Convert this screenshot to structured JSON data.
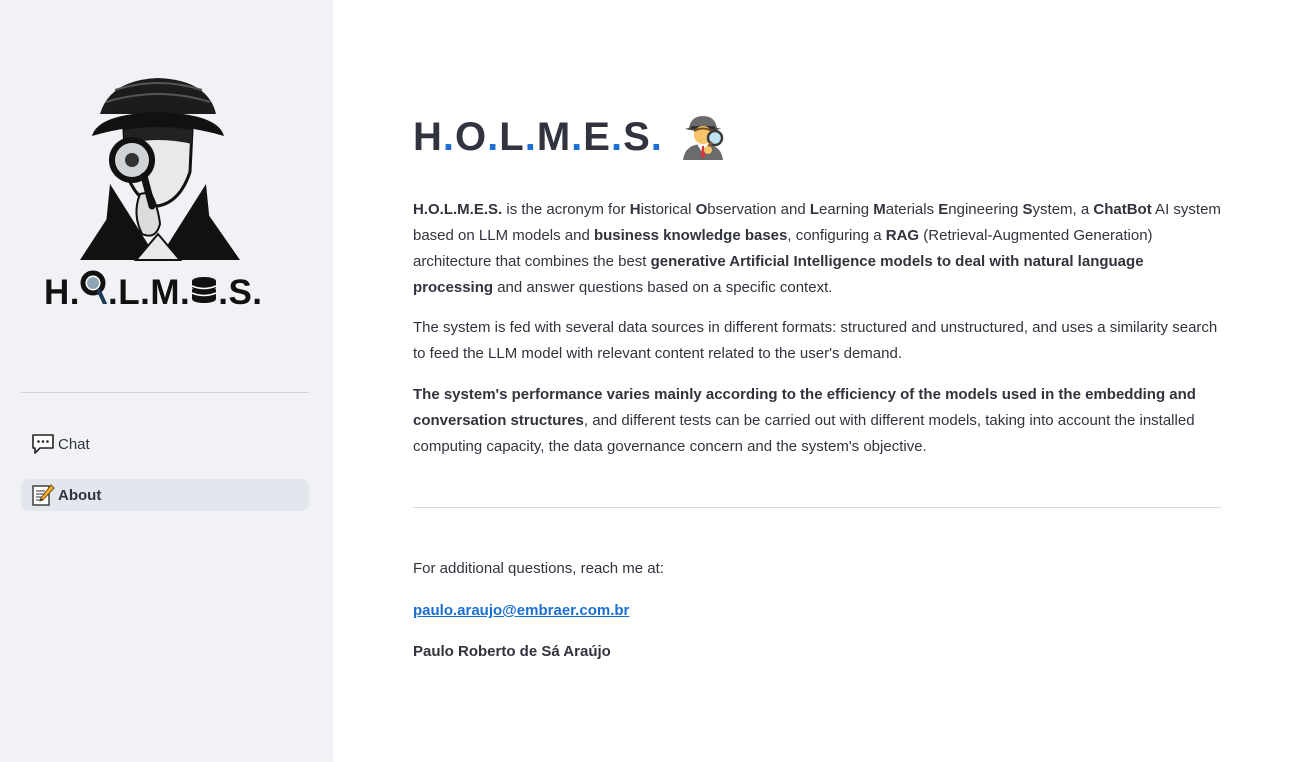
{
  "sidebar": {
    "logo_text": {
      "part1": "H.",
      "part2": ".L.M.",
      "part3": ".S."
    },
    "nav": [
      {
        "label": "Chat",
        "icon": "speech-balloon-icon",
        "active": false
      },
      {
        "label": "About",
        "icon": "memo-icon",
        "active": true
      }
    ]
  },
  "main": {
    "title": {
      "letters": [
        "H",
        "O",
        "L",
        "M",
        "E",
        "S"
      ],
      "icon": "detective-icon"
    },
    "para1": {
      "s1": "H.O.L.M.E.S.",
      "s2": " is the acronym for ",
      "h": "H",
      "h_rest": "istorical ",
      "o": "O",
      "o_rest": "bservation and ",
      "l": "L",
      "l_rest": "earning ",
      "m": "M",
      "m_rest": "aterials ",
      "e": "E",
      "e_rest": "ngineering ",
      "s": "S",
      "s_rest": "ystem, a ",
      "chatbot": "ChatBot",
      "s3": " AI system based on LLM models and ",
      "bkb": "business knowledge bases",
      "s4": ", configuring a ",
      "rag": "RAG",
      "s5": " (Retrieval-Augmented Generation) architecture that combines the best ",
      "gen": "generative Artificial Intelligence models to deal with natural language processing",
      "s6": " and answer questions based on a specific context."
    },
    "para2": "The system is fed with several data sources in different formats: structured and unstructured, and uses a similarity search to feed the LLM model with relevant content related to the user's demand.",
    "para3": {
      "bold": "The system's performance varies mainly according to the efficiency of the models used in the embedding and conversation structures",
      "rest": ", and different tests can be carried out with different models, taking into account the installed computing capacity, the data governance concern and the system's objective."
    },
    "contact_label": "For additional questions, reach me at:",
    "email": "paulo.araujo@embraer.com.br",
    "author": "Paulo Roberto de Sá Araújo"
  },
  "colors": {
    "sidebar_bg": "#f0f2f6",
    "accent_dot": "#1a6fd4",
    "link": "#1a6fd4",
    "text": "#31333f"
  }
}
